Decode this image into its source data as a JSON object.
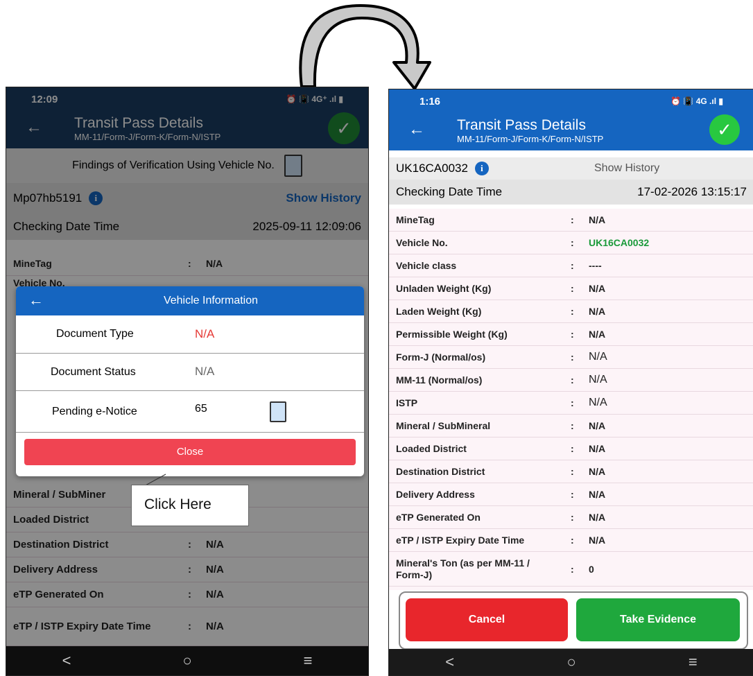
{
  "left": {
    "status": {
      "time": "12:09",
      "icons": "⏰ 📳 4G⁺ .ıl ▮"
    },
    "appbar": {
      "title": "Transit Pass Details",
      "subtitle": "MM-11/Form-J/Form-K/Form-N/ISTP"
    },
    "findings_label": "Findings of Verification Using Vehicle No.",
    "vehicle_no": "Mp07hb5191",
    "show_history": "Show History",
    "checking_label": "Checking Date Time",
    "checking_value": "2025-09-11 12:09:06",
    "details": [
      {
        "label": "MineTag",
        "value": "N/A"
      },
      {
        "label": "Mineral / SubMiner",
        "value": ""
      },
      {
        "label": "Loaded District",
        "value": ""
      },
      {
        "label": "Destination District",
        "value": "N/A"
      },
      {
        "label": "Delivery Address",
        "value": "N/A"
      },
      {
        "label": "eTP Generated On",
        "value": "N/A"
      },
      {
        "label": "eTP / ISTP Expiry Date Time",
        "value": "N/A"
      }
    ],
    "partial_vehicle": "Vehicle No.",
    "modal": {
      "title": "Vehicle Information",
      "rows": [
        {
          "label": "Document Type",
          "value": "N/A"
        },
        {
          "label": "Document Status",
          "value": "N/A"
        },
        {
          "label": "Pending e-Notice",
          "value": "65"
        }
      ],
      "close": "Close"
    },
    "callout": "Click Here"
  },
  "right": {
    "status": {
      "time": "1:16",
      "icons": "⏰ 📳 4G .ıl ▮"
    },
    "appbar": {
      "title": "Transit Pass Details",
      "subtitle": "MM-11/Form-J/Form-K/Form-N/ISTP"
    },
    "vehicle_no": "UK16CA0032",
    "show_history": "Show History",
    "checking_label": "Checking Date Time",
    "checking_value": "17-02-2026 13:15:17",
    "details": [
      {
        "label": "MineTag",
        "value": "N/A"
      },
      {
        "label": "Vehicle No.",
        "value": "UK16CA0032"
      },
      {
        "label": "Vehicle class",
        "value": "----"
      },
      {
        "label": "Unladen Weight (Kg)",
        "value": "N/A"
      },
      {
        "label": "Laden Weight (Kg)",
        "value": "N/A"
      },
      {
        "label": "Permissible Weight (Kg)",
        "value": "N/A"
      },
      {
        "label": "Form-J (Normal/os)",
        "value": "N/A"
      },
      {
        "label": "MM-11 (Normal/os)",
        "value": "N/A"
      },
      {
        "label": "ISTP",
        "value": "N/A"
      },
      {
        "label": "Mineral / SubMineral",
        "value": "N/A"
      },
      {
        "label": "Loaded District",
        "value": "N/A"
      },
      {
        "label": "Destination District",
        "value": "N/A"
      },
      {
        "label": "Delivery Address",
        "value": "N/A"
      },
      {
        "label": "eTP Generated On",
        "value": "N/A"
      },
      {
        "label": "eTP / ISTP Expiry Date Time",
        "value": "N/A"
      },
      {
        "label": "Mineral's Ton (as per MM-11 / Form-J)",
        "value": "0"
      }
    ],
    "buttons": {
      "cancel": "Cancel",
      "take_evidence": "Take Evidence"
    }
  },
  "nav": {
    "back": "<",
    "home": "○",
    "menu": "≡"
  },
  "colors": {
    "appbar": "#1565c0",
    "check": "#28c840",
    "close": "#f04452",
    "cancel": "#e8262c",
    "evidence": "#1fa83d",
    "green_value": "#1a9a3a",
    "red_value": "#e53935"
  }
}
